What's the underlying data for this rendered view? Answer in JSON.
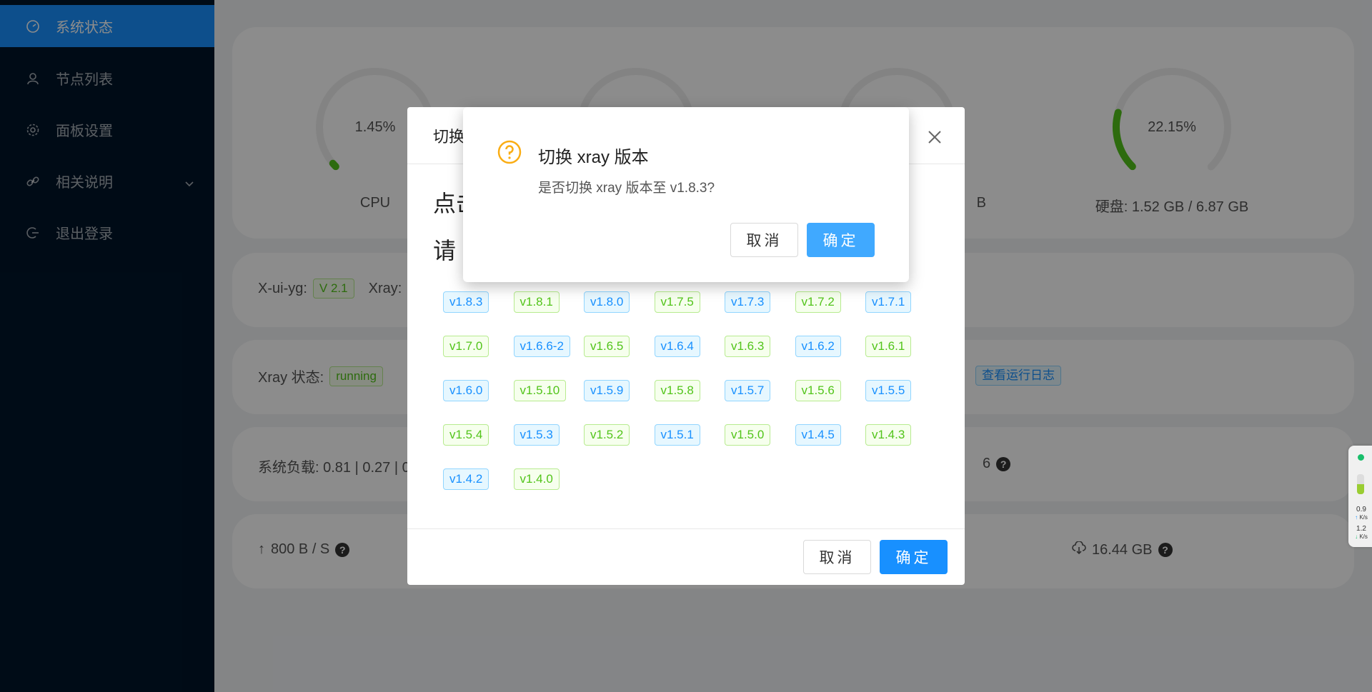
{
  "sidebar": {
    "items": [
      {
        "label": "系统状态",
        "active": true
      },
      {
        "label": "节点列表"
      },
      {
        "label": "面板设置"
      },
      {
        "label": "相关说明"
      },
      {
        "label": "退出登录"
      }
    ]
  },
  "dashboard": {
    "gauges": [
      {
        "value": "1.45%",
        "label": "CPU"
      },
      {
        "value": "",
        "label": ""
      },
      {
        "value": "",
        "label": "B"
      },
      {
        "value": "22.15%",
        "label": "硬盘: 1.52 GB / 6.87 GB"
      }
    ],
    "version_row": {
      "label": "X-ui-yg:",
      "version": "V 2.1",
      "xray_label": "Xray:"
    },
    "status_row": {
      "label": "Xray 状态:",
      "status": "running",
      "log_link": "查看运行日志"
    },
    "load_row": {
      "label": "系统负载: 0.81 | 0.27 | 0",
      "right_text": "6"
    },
    "net_row": {
      "upload": "800 B / S",
      "total_download": "16.44 GB"
    }
  },
  "version_modal": {
    "title": "切换",
    "line1": "点击",
    "line2": "请",
    "versions": [
      "v1.8.3",
      "v1.8.1",
      "v1.8.0",
      "v1.7.5",
      "v1.7.3",
      "v1.7.2",
      "v1.7.1",
      "v1.7.0",
      "v1.6.6-2",
      "v1.6.5",
      "v1.6.4",
      "v1.6.3",
      "v1.6.2",
      "v1.6.1",
      "v1.6.0",
      "v1.5.10",
      "v1.5.9",
      "v1.5.8",
      "v1.5.7",
      "v1.5.6",
      "v1.5.5",
      "v1.5.4",
      "v1.5.3",
      "v1.5.2",
      "v1.5.1",
      "v1.5.0",
      "v1.4.5",
      "v1.4.3",
      "v1.4.2",
      "v1.4.0"
    ],
    "cancel": "取消",
    "ok": "确定"
  },
  "confirm": {
    "title": "切换 xray 版本",
    "content": "是否切换 xray 版本至 v1.8.3?",
    "cancel": "取消",
    "ok": "确定"
  },
  "net_widget": {
    "up_value": "0.9",
    "up_unit": "K/s",
    "down_value": "1.2",
    "down_unit": "K/s"
  },
  "colors": {
    "sidebar_bg": "#001529",
    "accent": "#1890ff",
    "gauge_green": "#52c41a",
    "warning": "#faad14"
  }
}
